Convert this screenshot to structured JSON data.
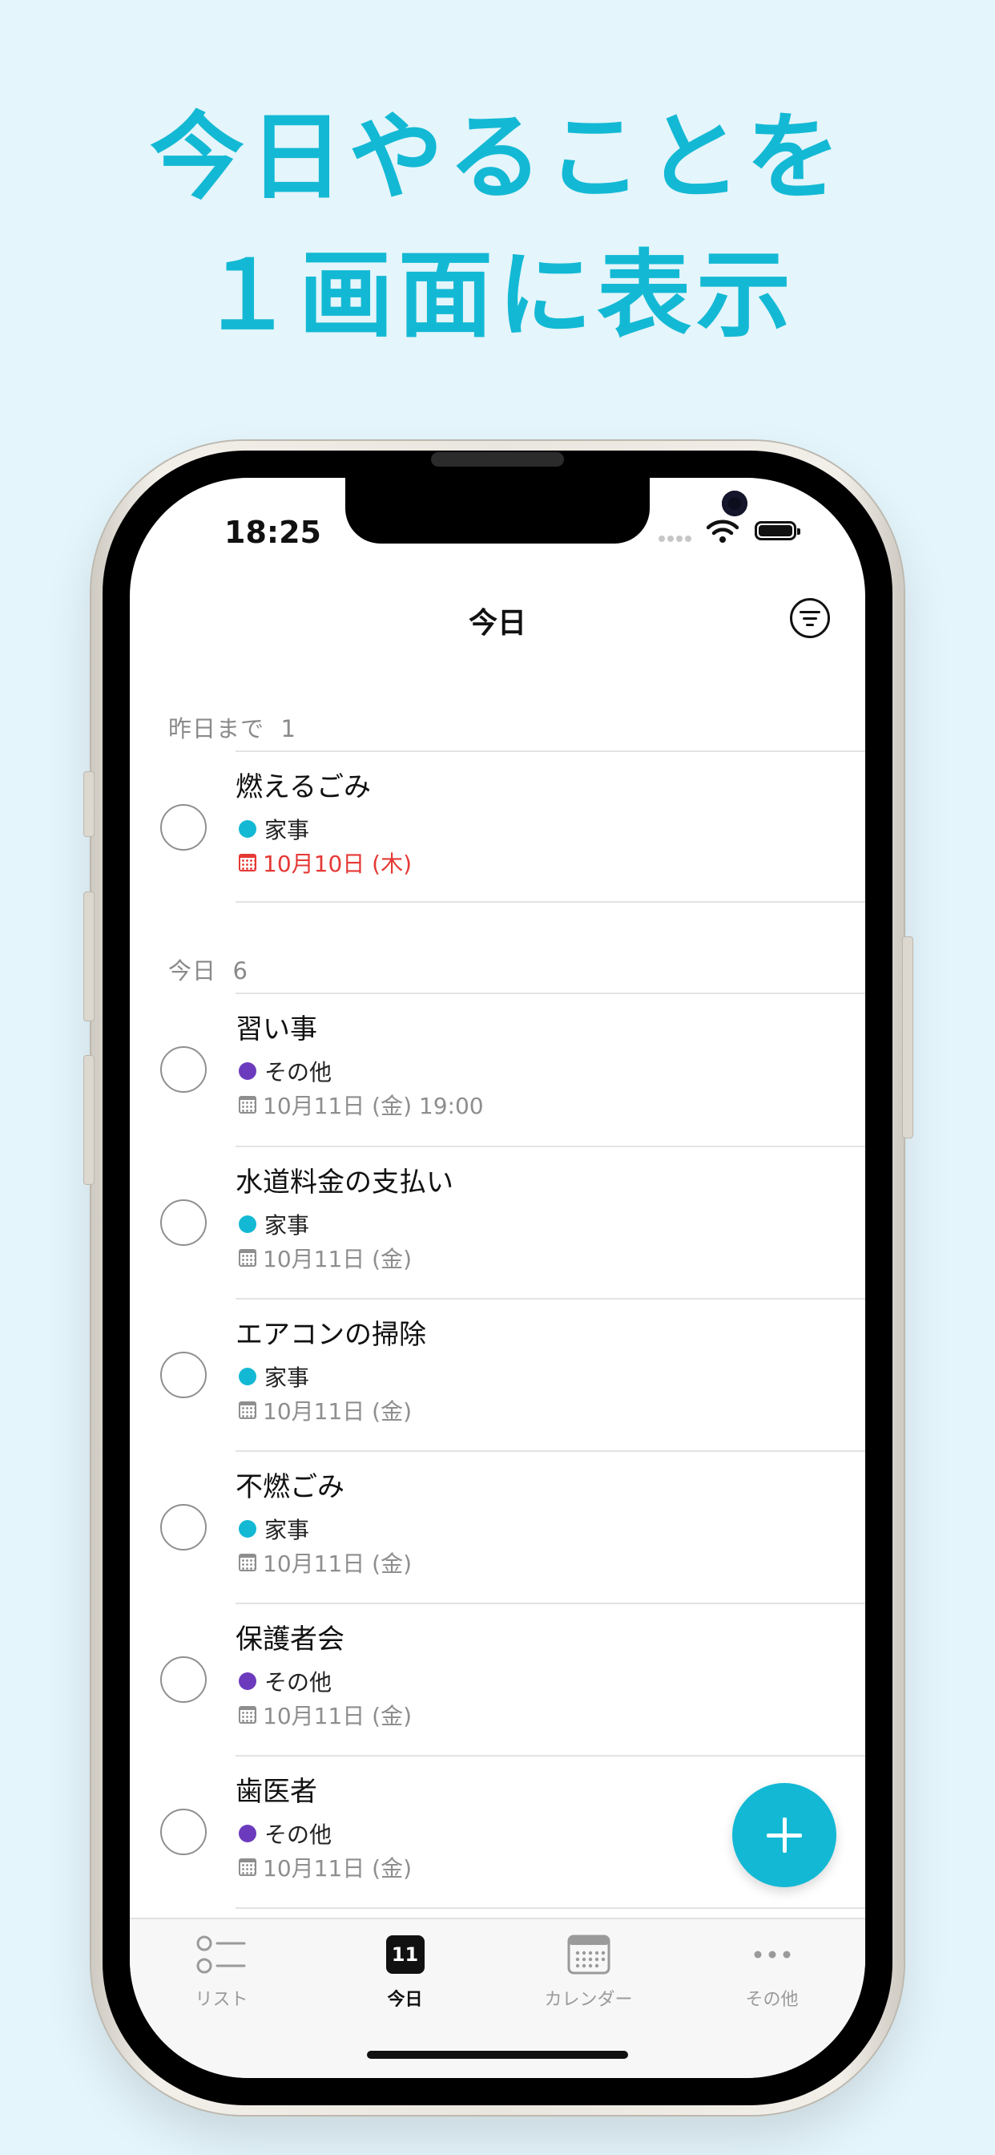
{
  "headline": {
    "line1": "今日やることを",
    "line2": "１画面に表示"
  },
  "status_bar": {
    "time": "18:25"
  },
  "nav": {
    "title": "今日"
  },
  "colors": {
    "accent": "#13b9d4",
    "housework": "#13b9d4",
    "other": "#6c3bbd",
    "overdue": "#e53935"
  },
  "sections": [
    {
      "label": "昨日まで",
      "count": "1"
    },
    {
      "label": "今日",
      "count": "6"
    }
  ],
  "tasks": [
    {
      "title": "燃えるごみ",
      "category": "家事",
      "date": "10月10日 (木)"
    },
    {
      "title": "習い事",
      "category": "その他",
      "date": "10月11日 (金) 19:00"
    },
    {
      "title": "水道料金の支払い",
      "category": "家事",
      "date": "10月11日 (金)"
    },
    {
      "title": "エアコンの掃除",
      "category": "家事",
      "date": "10月11日 (金)"
    },
    {
      "title": "不燃ごみ",
      "category": "家事",
      "date": "10月11日 (金)"
    },
    {
      "title": "保護者会",
      "category": "その他",
      "date": "10月11日 (金)"
    },
    {
      "title": "歯医者",
      "category": "その他",
      "date": "10月11日 (金)"
    }
  ],
  "tabbar": {
    "items": [
      {
        "label": "リスト",
        "icon": "list-icon"
      },
      {
        "label": "今日",
        "icon": "today-icon",
        "badge": "11"
      },
      {
        "label": "カレンダー",
        "icon": "calendar-icon"
      },
      {
        "label": "その他",
        "icon": "more-icon"
      }
    ]
  }
}
